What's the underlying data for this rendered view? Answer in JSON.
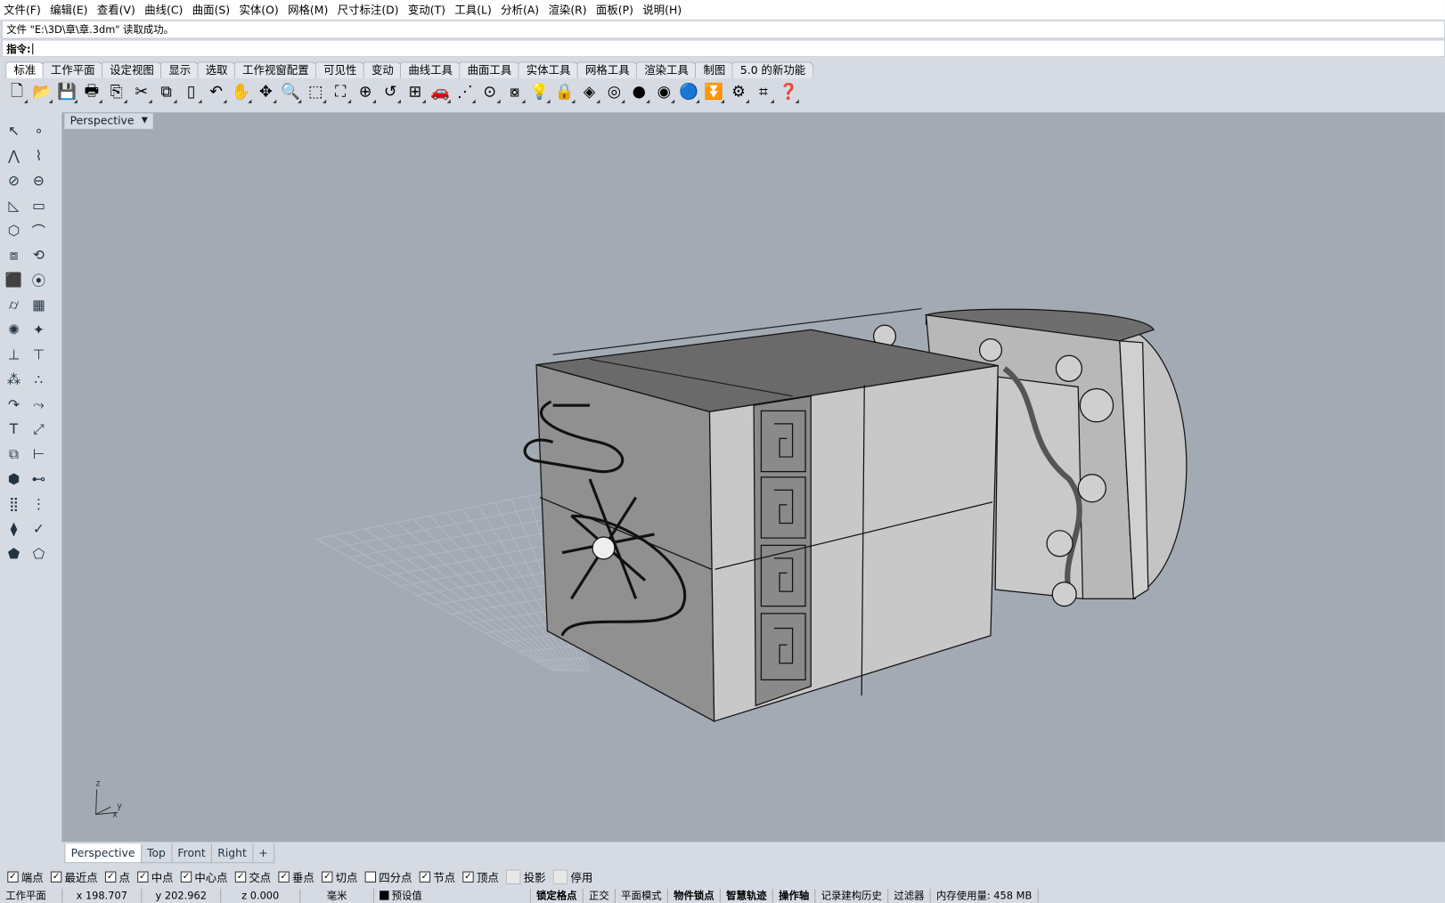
{
  "menu": [
    "文件(F)",
    "编辑(E)",
    "查看(V)",
    "曲线(C)",
    "曲面(S)",
    "实体(O)",
    "网格(M)",
    "尺寸标注(D)",
    "变动(T)",
    "工具(L)",
    "分析(A)",
    "渲染(R)",
    "面板(P)",
    "说明(H)"
  ],
  "command": {
    "history": "文件 \"E:\\3D\\章\\章.3dm\" 读取成功。",
    "prompt": "指令:"
  },
  "toolbar_tabs": [
    "标准",
    "工作平面",
    "设定视图",
    "显示",
    "选取",
    "工作视窗配置",
    "可见性",
    "变动",
    "曲线工具",
    "曲面工具",
    "实体工具",
    "网格工具",
    "渲染工具",
    "制图",
    "5.0 的新功能"
  ],
  "toolbar_icons": [
    {
      "name": "new-icon",
      "g": "🗋"
    },
    {
      "name": "open-icon",
      "g": "📂"
    },
    {
      "name": "save-icon",
      "g": "💾"
    },
    {
      "name": "print-icon",
      "g": "🖶"
    },
    {
      "name": "export-icon",
      "g": "⎘"
    },
    {
      "name": "cut-icon",
      "g": "✂"
    },
    {
      "name": "copy-icon",
      "g": "⧉"
    },
    {
      "name": "paste-icon",
      "g": "▯"
    },
    {
      "name": "undo-icon",
      "g": "↶"
    },
    {
      "name": "pan-hand-icon",
      "g": "✋"
    },
    {
      "name": "rotate-view-icon",
      "g": "✥"
    },
    {
      "name": "zoom-icon",
      "g": "🔍"
    },
    {
      "name": "zoom-window-icon",
      "g": "⬚"
    },
    {
      "name": "zoom-extents-icon",
      "g": "⛶"
    },
    {
      "name": "zoom-selected-icon",
      "g": "⊕"
    },
    {
      "name": "undo-view-icon",
      "g": "↺"
    },
    {
      "name": "four-viewports-icon",
      "g": "⊞"
    },
    {
      "name": "car-icon",
      "g": "🚗"
    },
    {
      "name": "grid-icon",
      "g": "⋰"
    },
    {
      "name": "cplane-icon",
      "g": "⊙"
    },
    {
      "name": "object-props-icon",
      "g": "⧇"
    },
    {
      "name": "light-bulb-icon",
      "g": "💡"
    },
    {
      "name": "lock-icon",
      "g": "🔒"
    },
    {
      "name": "layer-icon",
      "g": "◈"
    },
    {
      "name": "color-wheel-icon",
      "g": "◎"
    },
    {
      "name": "shaded-sphere-icon",
      "g": "●"
    },
    {
      "name": "render-sphere-icon",
      "g": "◉"
    },
    {
      "name": "rendered-blue-sphere-icon",
      "g": "🔵"
    },
    {
      "name": "filter-icon",
      "g": "⏬"
    },
    {
      "name": "options-gear-icon",
      "g": "⚙"
    },
    {
      "name": "snap-icon",
      "g": "⌗"
    },
    {
      "name": "help-icon",
      "g": "❓"
    }
  ],
  "left_icons": [
    {
      "name": "select-arrow-icon",
      "g": "↖"
    },
    {
      "name": "point-icon",
      "g": "∘"
    },
    {
      "name": "polyline-icon",
      "g": "⋀"
    },
    {
      "name": "curve-icon",
      "g": "⌇"
    },
    {
      "name": "circle-icon",
      "g": "⊘"
    },
    {
      "name": "ellipse-icon",
      "g": "⊖"
    },
    {
      "name": "arc-icon",
      "g": "◺"
    },
    {
      "name": "rectangle-icon",
      "g": "▭"
    },
    {
      "name": "polygon-icon",
      "g": "⬡"
    },
    {
      "name": "fillet-curve-icon",
      "g": "⌒"
    },
    {
      "name": "surface-points-icon",
      "g": "⧈"
    },
    {
      "name": "revolve-icon",
      "g": "⟲"
    },
    {
      "name": "box-solid-icon",
      "g": "⬛"
    },
    {
      "name": "boolean-icon",
      "g": "⦿"
    },
    {
      "name": "extrude-icon",
      "g": "⌭"
    },
    {
      "name": "mesh-icon",
      "g": "▦"
    },
    {
      "name": "transform-gear-icon",
      "g": "✺"
    },
    {
      "name": "explode-icon",
      "g": "✦"
    },
    {
      "name": "trim-icon",
      "g": "⊥"
    },
    {
      "name": "split-icon",
      "g": "⊤"
    },
    {
      "name": "group-icon",
      "g": "⁂"
    },
    {
      "name": "ungroup-icon",
      "g": "∴"
    },
    {
      "name": "blend-curve-icon",
      "g": "↷"
    },
    {
      "name": "offset-curve-icon",
      "g": "⤳"
    },
    {
      "name": "text-icon",
      "g": "T"
    },
    {
      "name": "scale-icon",
      "g": "⤢"
    },
    {
      "name": "array-icon",
      "g": "⧉"
    },
    {
      "name": "dimension-icon",
      "g": "⊢"
    },
    {
      "name": "block-icon",
      "g": "⬢"
    },
    {
      "name": "linear-dim-icon",
      "g": "⊷"
    },
    {
      "name": "grid-array-icon",
      "g": "⣿"
    },
    {
      "name": "align-icon",
      "g": "⋮"
    },
    {
      "name": "analyze-icon",
      "g": "⧫"
    },
    {
      "name": "check-icon",
      "g": "✓"
    },
    {
      "name": "render-mesh-icon",
      "g": "⬟"
    },
    {
      "name": "paint-icon",
      "g": "⬠"
    }
  ],
  "viewport": {
    "title": "Perspective",
    "bg": "#a3aab3"
  },
  "viewport_tabs": [
    "Perspective",
    "Top",
    "Front",
    "Right",
    "+"
  ],
  "osnaps": [
    {
      "label": "端点",
      "checked": true
    },
    {
      "label": "最近点",
      "checked": true
    },
    {
      "label": "点",
      "checked": true
    },
    {
      "label": "中点",
      "checked": true
    },
    {
      "label": "中心点",
      "checked": true
    },
    {
      "label": "交点",
      "checked": true
    },
    {
      "label": "垂点",
      "checked": true
    },
    {
      "label": "切点",
      "checked": true
    },
    {
      "label": "四分点",
      "checked": false
    },
    {
      "label": "节点",
      "checked": true
    },
    {
      "label": "顶点",
      "checked": true
    },
    {
      "label": "投影",
      "checked": false
    },
    {
      "label": "停用",
      "checked": false
    }
  ],
  "status": {
    "cplane": "工作平面",
    "x": "x 198.707",
    "y": "y 202.962",
    "z": "z 0.000",
    "units": "毫米",
    "layer": "预设值",
    "grid_snap": "锁定格点",
    "ortho": "正交",
    "planar": "平面模式",
    "osnap": "物件锁点",
    "smarttrack": "智慧轨迹",
    "gumball": "操作轴",
    "history": "记录建构历史",
    "filter": "过滤器",
    "memory": "内存使用量: 458 MB"
  },
  "axis": {
    "z": "z",
    "y": "y",
    "x": "x"
  }
}
